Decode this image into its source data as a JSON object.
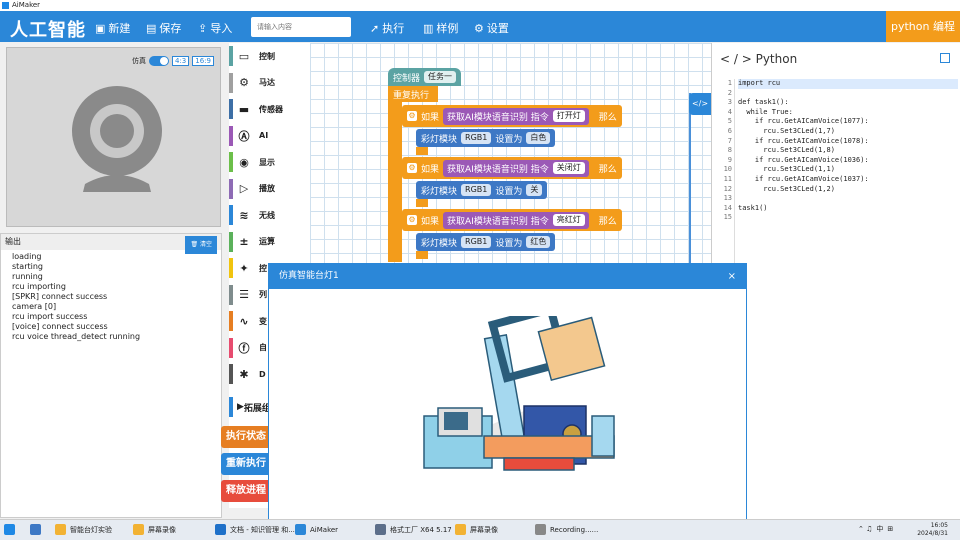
{
  "window": {
    "title": "AiMaker"
  },
  "header": {
    "brand": "人工智能",
    "new_label": "新建",
    "save_label": "保存",
    "import_label": "导入",
    "search_placeholder": "请输入内容",
    "run_label": "执行",
    "examples_label": "样例",
    "settings_label": "设置",
    "python_btn": "python 编程"
  },
  "camera": {
    "sim_label": "仿真",
    "ratio1": "4:3",
    "ratio2": "16:9"
  },
  "output": {
    "title": "输出",
    "clear_label": "清空",
    "lines": [
      "loading",
      "starting",
      "running",
      "rcu importing",
      "[SPKR] connect success",
      "camera  [0]",
      "rcu import success",
      "[voice] connect success",
      "rcu voice thread_detect running"
    ]
  },
  "categories": [
    {
      "label": "控制",
      "color": "#5ba3a3",
      "icon": "monitor-icon"
    },
    {
      "label": "马达",
      "color": "#a0a0a0",
      "icon": "motor-icon"
    },
    {
      "label": "传感器",
      "color": "#3d6fa6",
      "icon": "sensor-icon"
    },
    {
      "label": "AI",
      "color": "#9b59b6",
      "icon": "ai-icon"
    },
    {
      "label": "显示",
      "color": "#6cbf4a",
      "icon": "eye-icon"
    },
    {
      "label": "播放",
      "color": "#8e6bb5",
      "icon": "play-icon"
    },
    {
      "label": "无线",
      "color": "#2b87d8",
      "icon": "wifi-icon"
    },
    {
      "label": "运算",
      "color": "#5bb15b",
      "icon": "math-icon"
    },
    {
      "label": "控",
      "color": "#f1c40f",
      "icon": "control-icon"
    },
    {
      "label": "列",
      "color": "#7f8c8d",
      "icon": "list-icon"
    },
    {
      "label": "变",
      "color": "#e67e22",
      "icon": "variable-icon"
    },
    {
      "label": "自",
      "color": "#e74c6f",
      "icon": "function-icon"
    },
    {
      "label": "D",
      "color": "#555555",
      "icon": "debug-icon"
    }
  ],
  "expand_label": "拓展组",
  "side_buttons": [
    {
      "label": "执行状态",
      "color": "#e67e22"
    },
    {
      "label": "重新执行",
      "color": "#2b87d8"
    },
    {
      "label": "释放进程",
      "color": "#e74c3c"
    }
  ],
  "blocks": {
    "controller": "控制器",
    "task": "任务一",
    "repeat": "重复执行",
    "if": "如果",
    "ai_voice": "获取AI模块语音识别 指令",
    "then": "那么",
    "rgb_module": "彩灯模块",
    "rgb1": "RGB1",
    "set_to": "设置为",
    "rows": [
      {
        "cmd": "打开灯",
        "value": "白色"
      },
      {
        "cmd": "关闭灯",
        "value": "关"
      },
      {
        "cmd": "亮红灯",
        "value": "红色"
      }
    ]
  },
  "python": {
    "title": "< / > Python",
    "code_lines": [
      "import rcu",
      "",
      "def task1():",
      "  while True:",
      "    if rcu.GetAICamVoice(1077):",
      "      rcu.Set3CLed(1,7)",
      "    if rcu.GetAICamVoice(1078):",
      "      rcu.Set3CLed(1,8)",
      "    if rcu.GetAICamVoice(1036):",
      "      rcu.Set3CLed(1,1)",
      "    if rcu.GetAICamVoice(1037):",
      "      rcu.Set3CLed(1,2)",
      "",
      "task1()",
      ""
    ]
  },
  "modal": {
    "title": "仿真智能台灯1",
    "close": "×"
  },
  "taskbar": {
    "items": [
      "智能台灯实验",
      "屏幕录像",
      "文档 - 知识管理 和...",
      "AiMaker",
      "格式工厂 X64 5.17",
      "屏幕录像",
      "Recording......"
    ],
    "ime": "中",
    "time": "16:05",
    "date": "2024/8/31"
  }
}
